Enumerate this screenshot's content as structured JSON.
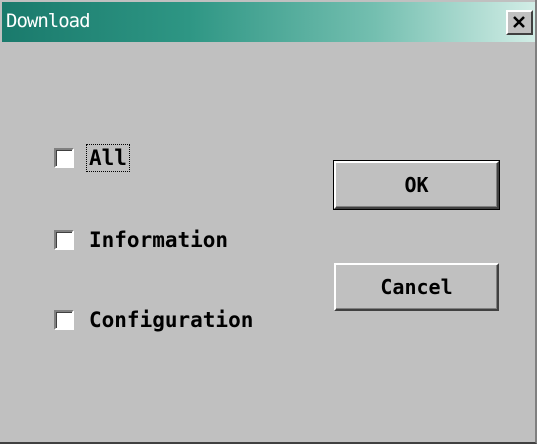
{
  "window": {
    "title": "Download"
  },
  "checkboxes": [
    {
      "label": "All",
      "checked": false,
      "focused": true
    },
    {
      "label": "Information",
      "checked": false,
      "focused": false
    },
    {
      "label": "Configuration",
      "checked": false,
      "focused": false
    }
  ],
  "buttons": {
    "ok_label": "OK",
    "cancel_label": "Cancel"
  },
  "colors": {
    "face": "#c0c0c0",
    "title_start": "#1a7a6c",
    "title_end": "#d2ede6"
  }
}
